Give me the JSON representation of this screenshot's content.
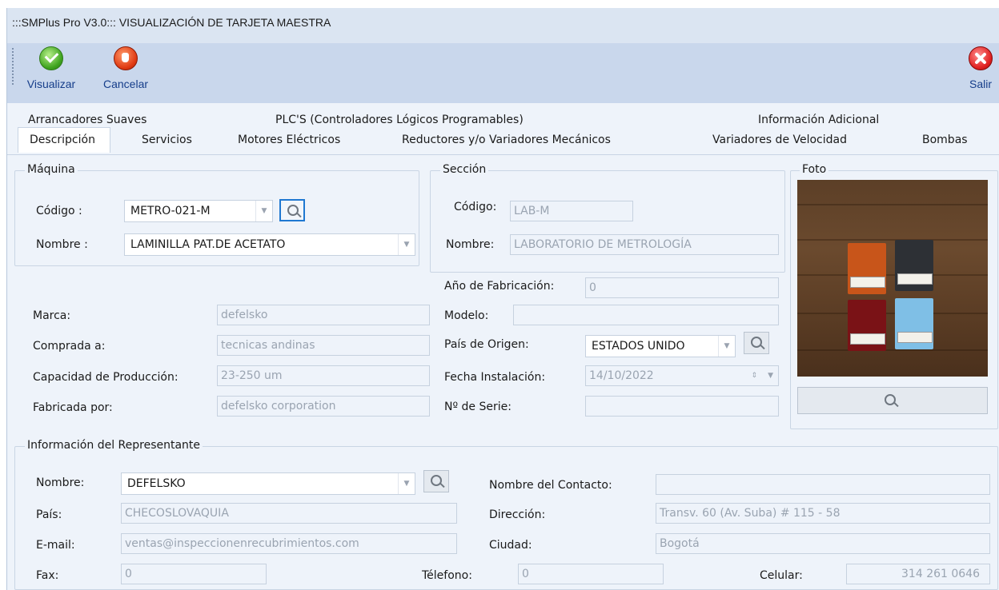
{
  "window": {
    "title": ":::SMPlus Pro V3.0::: VISUALIZACIÓN DE TARJETA MAESTRA"
  },
  "toolbar": {
    "visualize_label": "Visualizar",
    "cancel_label": "Cancelar",
    "exit_label": "Salir"
  },
  "tabs": {
    "row1": [
      "Arrancadores Suaves",
      "PLC'S (Controladores Lógicos Programables)",
      "Información Adicional"
    ],
    "row2": [
      "Descripción",
      "Servicios",
      "Motores Eléctricos",
      "Reductores y/o Variadores Mecánicos",
      "Variadores de Velocidad",
      "Bombas"
    ],
    "active": "Descripción"
  },
  "maquina": {
    "legend": "Máquina",
    "codigo_label": "Código :",
    "codigo_value": "METRO-021-M",
    "nombre_label": "Nombre :",
    "nombre_value": "LAMINILLA PAT.DE ACETATO"
  },
  "seccion": {
    "legend": "Sección",
    "codigo_label": "Código:",
    "codigo_value": "LAB-M",
    "nombre_label": "Nombre:",
    "nombre_value": "LABORATORIO DE METROLOGÍA"
  },
  "foto": {
    "legend": "Foto"
  },
  "details": {
    "marca_label": "Marca:",
    "marca_value": "defelsko",
    "comprada_label": "Comprada a:",
    "comprada_value": "tecnicas andinas",
    "capacidad_label": "Capacidad de Producción:",
    "capacidad_value": "23-250 um",
    "fabricada_label": "Fabricada por:",
    "fabricada_value": "defelsko corporation",
    "anio_label": "Año de Fabricación:",
    "anio_value": "0",
    "modelo_label": "Modelo:",
    "modelo_value": "",
    "pais_origen_label": "País de Origen:",
    "pais_origen_value": "ESTADOS UNIDO",
    "fecha_label": "Fecha Instalación:",
    "fecha_value": "14/10/2022",
    "serie_label": "Nº de Serie:",
    "serie_value": ""
  },
  "representante": {
    "legend": "Información del Representante",
    "nombre_label": "Nombre:",
    "nombre_value": "DEFELSKO",
    "pais_label": "País:",
    "pais_value": "CHECOSLOVAQUIA",
    "email_label": "E-mail:",
    "email_value": "ventas@inspeccionenrecubrimientos.com",
    "fax_label": "Fax:",
    "fax_value": "0",
    "contacto_label": "Nombre del  Contacto:",
    "contacto_value": "",
    "direccion_label": "Dirección:",
    "direccion_value": "Transv. 60 (Av. Suba) # 115 - 58",
    "ciudad_label": "Ciudad:",
    "ciudad_value": "Bogotá",
    "telefono_label": "Télefono:",
    "telefono_value": "0",
    "celular_label": "Celular:",
    "celular_value": "314 261 0646"
  },
  "colors": {
    "toolbar_bg": "#c9d7ec",
    "panel_bg": "#eef3fa",
    "link_blue": "#153d8a",
    "disabled_text": "#9aa4b1"
  }
}
